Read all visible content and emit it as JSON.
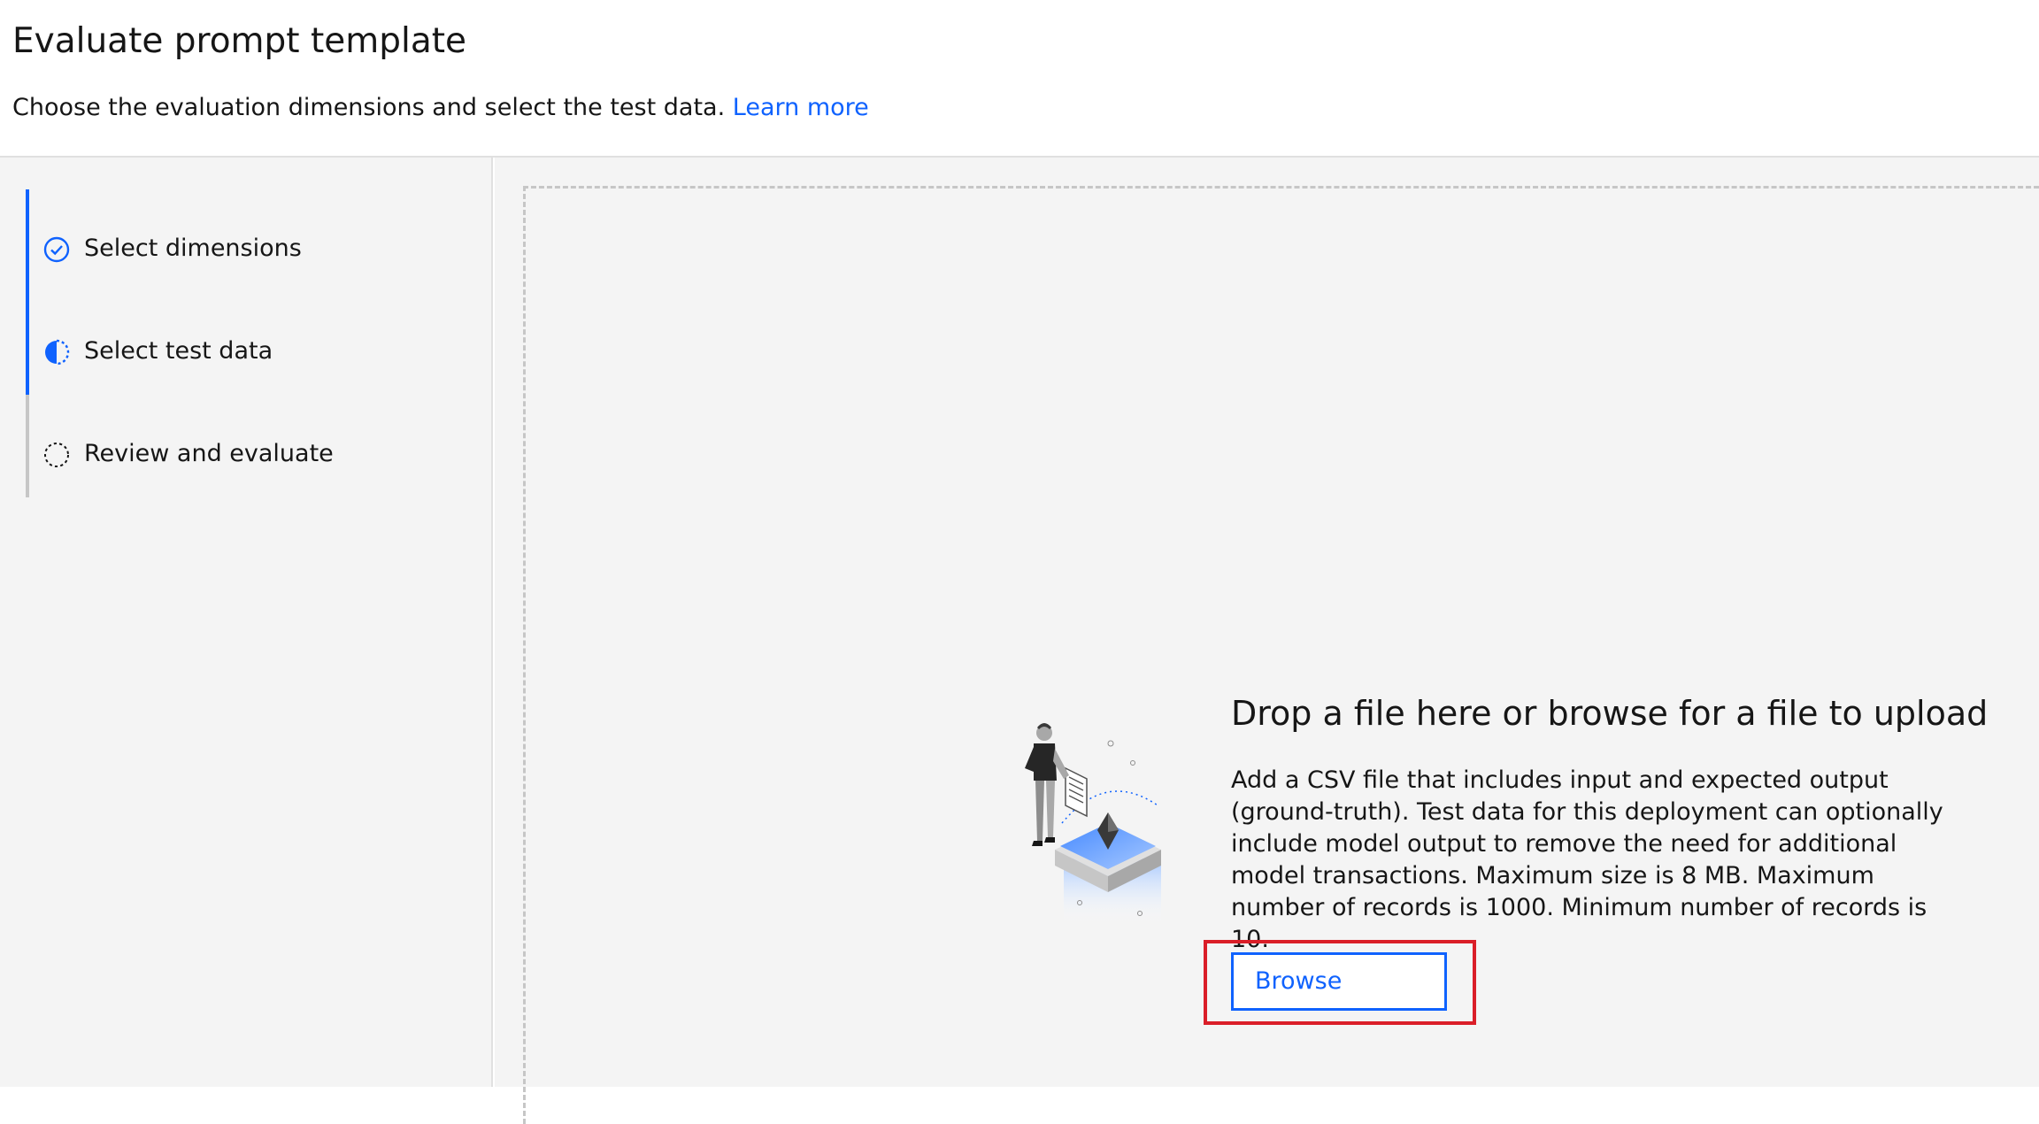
{
  "header": {
    "title": "Evaluate prompt template",
    "subtitle": "Choose the evaluation dimensions and select the test data.",
    "learn_more": "Learn more"
  },
  "steps": [
    {
      "label": "Select dimensions",
      "status": "complete",
      "icon": "checkmark-circle-icon"
    },
    {
      "label": "Select test data",
      "status": "current",
      "icon": "half-circle-icon"
    },
    {
      "label": "Review and evaluate",
      "status": "incomplete",
      "icon": "dashed-circle-icon"
    }
  ],
  "upload": {
    "title": "Drop a file here or browse for a file to upload",
    "description": "Add a CSV file that includes input and expected output (ground-truth). Test data for this deployment can optionally include model output to remove the need for additional model transactions. Maximum size is 8 MB. Maximum number of records is 1000. Minimum number of records is 10.",
    "browse_label": "Browse"
  },
  "colors": {
    "accent": "#0f62fe",
    "highlight": "#da1e28",
    "background": "#f4f4f4"
  }
}
